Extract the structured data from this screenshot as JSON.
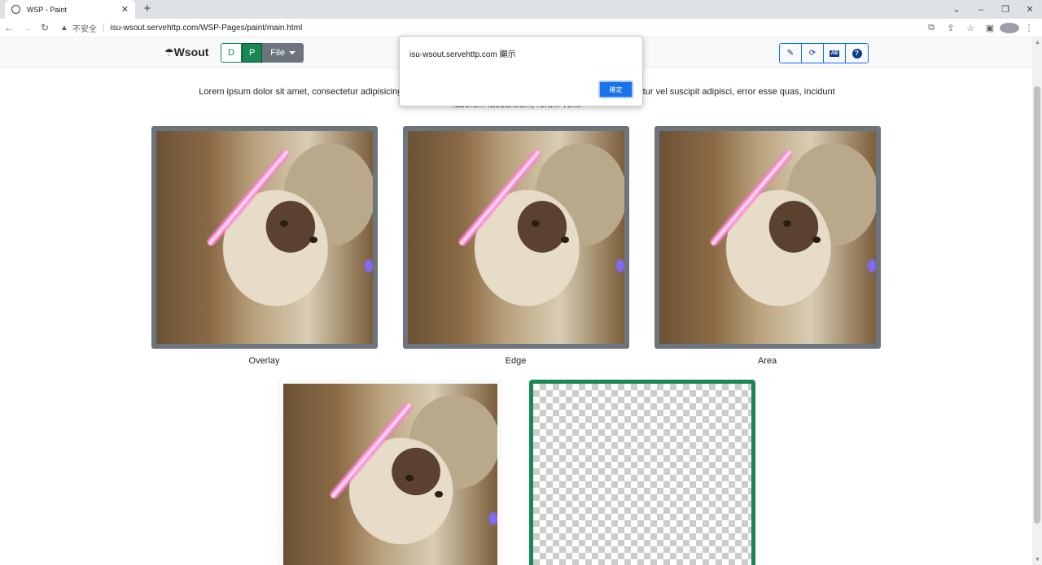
{
  "browser": {
    "tab_title": "WSP - Paint",
    "tab_close": "✕",
    "new_tab": "+",
    "security_label": "不安全",
    "url": "isu-wsout.servehttp.com/WSP-Pages/paint/main.html",
    "window_controls": [
      "⌄",
      "–",
      "❐",
      "✕"
    ]
  },
  "navbar": {
    "brand": "Wsout",
    "brand_icon": "☂",
    "mode_d": "D",
    "mode_p": "P",
    "file_menu": "File",
    "tools": {
      "brush": "✎",
      "refresh": "⟳",
      "ab": "AB",
      "help": "?"
    }
  },
  "intro_text": "Lorem ipsum dolor sit amet, consectetur adipisicing elit. Dolorem quos, accusantium temporibus quo consequuntur vel suscipit adipisci, error esse quas, incidunt laborum laudantium, rerum velit.",
  "gallery": {
    "labels": [
      "Overlay",
      "Edge",
      "Area"
    ]
  },
  "alert": {
    "message": "isu-wsout.servehttp.com 顯示",
    "ok_label": "確定"
  },
  "colors": {
    "accent_green": "#198754",
    "frame_gray": "#6c757d",
    "dialog_blue": "#1a73e8"
  }
}
